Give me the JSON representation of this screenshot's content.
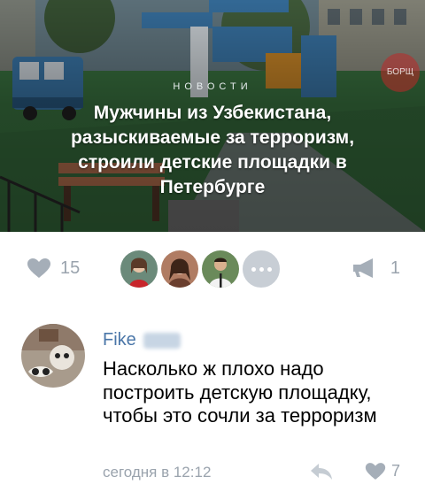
{
  "post_card": {
    "category": "НОВОСТИ",
    "headline": "Мужчины из Узбекистана, разыскиваемые за терроризм, строили детские площадки в Петербурге",
    "watermark": "БОРЩ"
  },
  "actions": {
    "like_icon": "heart-icon",
    "like_count": "15",
    "liked_by_avatars": [
      "avatar-1",
      "avatar-2",
      "avatar-3"
    ],
    "more_icon": "ellipsis-icon",
    "share_icon": "megaphone-icon",
    "share_count": "1"
  },
  "comment": {
    "author": "Fike",
    "text": "Насколько ж плохо надо построить детскую площадку, чтобы это сочли за терроризм",
    "time": "сегодня в 12:12",
    "reply_icon": "reply-icon",
    "like_icon": "heart-icon",
    "like_count": "7"
  },
  "colors": {
    "link": "#4a76a8",
    "muted": "#9aa3ad",
    "text": "#000000"
  }
}
